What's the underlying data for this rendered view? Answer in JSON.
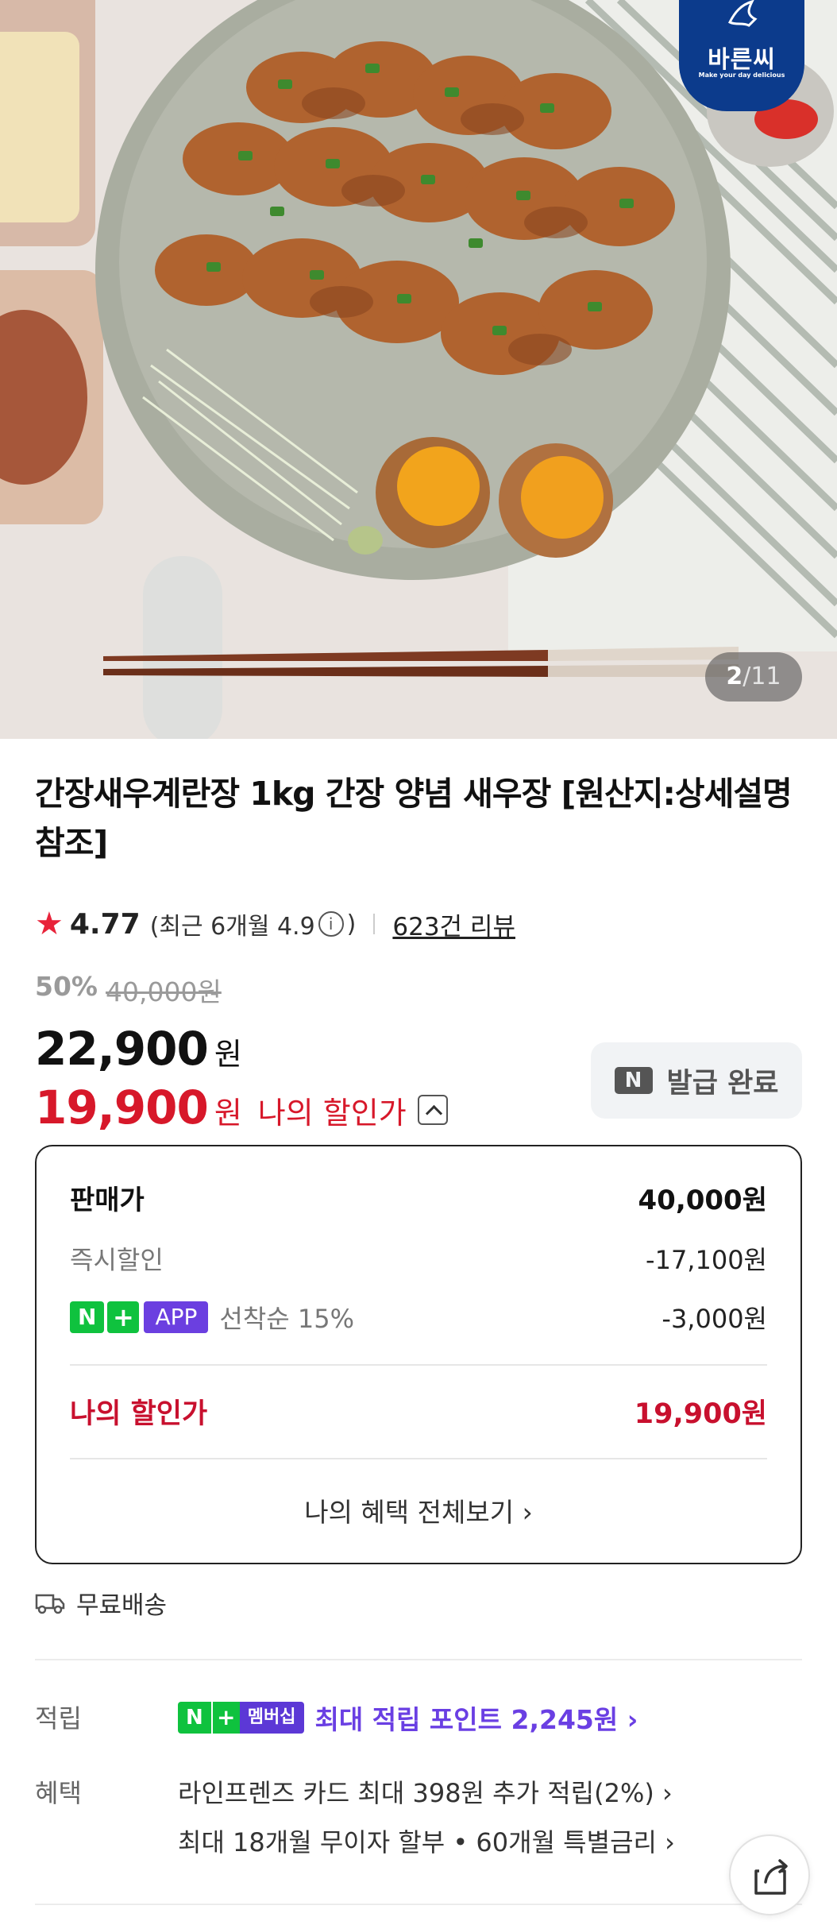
{
  "hero": {
    "brand_name": "바른씨",
    "brand_tagline": "Make your day delicious",
    "page_current": "2",
    "page_sep": "/",
    "page_total": "11"
  },
  "product": {
    "title": "간장새우계란장 1kg 간장 양념 새우장 [원산지:상세설명 참조]",
    "rating": "4.77",
    "recent_rating": "(최근 6개월 4.9",
    "recent_close": ")",
    "info_icon_glyph": "i",
    "review_count": "623건 리뷰"
  },
  "price": {
    "discount_rate": "50%",
    "original_price": "40,000원",
    "sale_price": "22,900",
    "sale_unit": "원",
    "my_price": "19,900",
    "my_unit": "원",
    "my_label": "나의 할인가"
  },
  "coupon": {
    "icon_text": "N",
    "label": "발급 완료"
  },
  "breakdown": {
    "list_price_label": "판매가",
    "list_price_value": "40,000원",
    "instant_label": "즉시할인",
    "instant_value": "-17,100원",
    "np_badge": "N",
    "np_plus": "+",
    "app_badge": "APP",
    "first_come_label": "선착순 15%",
    "first_come_value": "-3,000원",
    "my_price_label": "나의 할인가",
    "my_price_value": "19,900원",
    "view_all": "나의 혜택 전체보기 ›"
  },
  "shipping": {
    "label": "무료배송"
  },
  "earn": {
    "label": "적립",
    "badge_n": "N",
    "badge_plus": "+",
    "badge_text": "멤버십",
    "value": "최대 적립 포인트 2,245원 ›"
  },
  "benefit": {
    "label": "혜택",
    "line1": "라인프렌즈 카드 최대 398원 추가 적립(2%) ›",
    "line2": "최대 18개월 무이자 할부 • 60개월 특별금리 ›"
  },
  "colors": {
    "accent_red": "#d7182a",
    "naver_green": "#0fc23e",
    "membership_purple": "#6a3fe3",
    "brand_navy": "#0c3b8c"
  },
  "icons": {
    "star": "star-icon",
    "info": "info-icon",
    "chevron_up": "chevron-up-icon",
    "truck": "truck-icon",
    "share": "share-icon"
  }
}
